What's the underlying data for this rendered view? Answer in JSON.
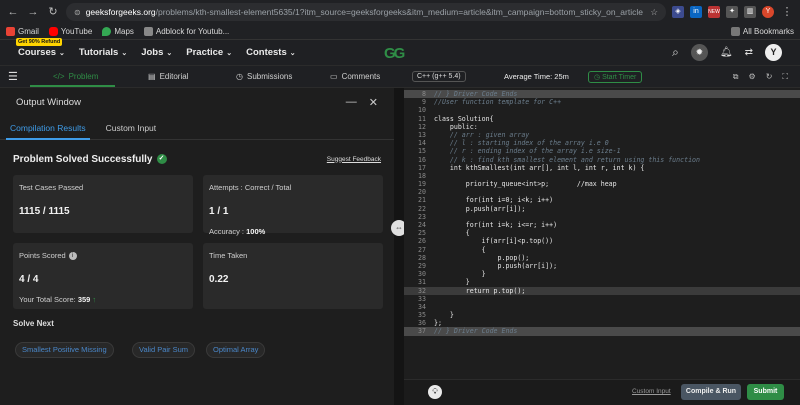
{
  "browser": {
    "url_domain": "geeksforgeeks.org",
    "url_rest": "/problems/kth-smallest-element5635/1?itm_source=geeksforgeeks&itm_medium=article&itm_campaign=bottom_sticky_on_article",
    "profile_initial": "Y",
    "ext_badge": "NEW"
  },
  "bookmarks": {
    "items": [
      "Gmail",
      "YouTube",
      "Maps",
      "Adblock for Youtub..."
    ],
    "all_label": "All Bookmarks"
  },
  "gfg_nav": {
    "refund_badge": "Get 90% Refund",
    "items": [
      "Courses",
      "Tutorials",
      "Jobs",
      "Practice",
      "Contests"
    ],
    "logo": "GG",
    "avatar": "Y"
  },
  "problem_tabs": [
    "Problem",
    "Editorial",
    "Submissions",
    "Comments"
  ],
  "editor_header": {
    "language": "C++ (g++ 5.4)",
    "avg_time": "Average Time: 25m",
    "start_timer": "Start Timer"
  },
  "output": {
    "title": "Output Window",
    "tabs": [
      "Compilation Results",
      "Custom Input"
    ],
    "status": "Problem Solved Successfully",
    "suggest_feedback": "Suggest Feedback",
    "cards": {
      "test_cases": {
        "label": "Test Cases Passed",
        "value": "1115 / 1115"
      },
      "attempts": {
        "label": "Attempts : Correct / Total",
        "value": "1 / 1",
        "sub_label": "Accuracy :",
        "sub_value": "100%"
      },
      "points": {
        "label": "Points Scored",
        "value": "4 / 4",
        "sub_label": "Your Total Score:",
        "sub_value": "359"
      },
      "time": {
        "label": "Time Taken",
        "value": "0.22"
      }
    },
    "solve_next": "Solve Next",
    "suggestions": [
      "Smallest Positive Missing",
      "Valid Pair Sum",
      "Optimal Array"
    ]
  },
  "code": {
    "lines": [
      {
        "n": "8",
        "t": "// } Driver Code Ends",
        "c": "cm",
        "hl": "greyhl"
      },
      {
        "n": "9",
        "t": "//User function template for C++",
        "c": "cm"
      },
      {
        "n": "10",
        "t": "",
        "c": ""
      },
      {
        "n": "11",
        "t": "class Solution{",
        "c": ""
      },
      {
        "n": "12",
        "t": "    public:",
        "c": ""
      },
      {
        "n": "13",
        "t": "    // arr : given array",
        "c": "cm"
      },
      {
        "n": "14",
        "t": "    // l : starting index of the array i.e 0",
        "c": "cm"
      },
      {
        "n": "15",
        "t": "    // r : ending index of the array i.e size-1",
        "c": "cm"
      },
      {
        "n": "16",
        "t": "    // k : find kth smallest element and return using this function",
        "c": "cm"
      },
      {
        "n": "17",
        "t": "    int kthSmallest(int arr[], int l, int r, int k) {",
        "c": ""
      },
      {
        "n": "18",
        "t": "",
        "c": ""
      },
      {
        "n": "19",
        "t": "        priority_queue<int>p;       //max heap",
        "c": ""
      },
      {
        "n": "20",
        "t": "",
        "c": ""
      },
      {
        "n": "21",
        "t": "        for(int i=0; i<k; i++)",
        "c": ""
      },
      {
        "n": "22",
        "t": "        p.push(arr[i]);",
        "c": ""
      },
      {
        "n": "23",
        "t": "",
        "c": ""
      },
      {
        "n": "24",
        "t": "        for(int i=k; i<=r; i++)",
        "c": ""
      },
      {
        "n": "25",
        "t": "        {",
        "c": ""
      },
      {
        "n": "26",
        "t": "            if(arr[i]<p.top())",
        "c": ""
      },
      {
        "n": "27",
        "t": "            {",
        "c": ""
      },
      {
        "n": "28",
        "t": "                p.pop();",
        "c": ""
      },
      {
        "n": "29",
        "t": "                p.push(arr[i]);",
        "c": ""
      },
      {
        "n": "30",
        "t": "            }",
        "c": ""
      },
      {
        "n": "31",
        "t": "        }",
        "c": ""
      },
      {
        "n": "32",
        "t": "        return p.top();",
        "c": "",
        "hl": "hl"
      },
      {
        "n": "33",
        "t": "",
        "c": ""
      },
      {
        "n": "34",
        "t": "",
        "c": ""
      },
      {
        "n": "35",
        "t": "    }",
        "c": ""
      },
      {
        "n": "36",
        "t": "};",
        "c": ""
      },
      {
        "n": "37",
        "t": "// } Driver Code Ends",
        "c": "cm",
        "hl": "greyhl"
      }
    ]
  },
  "editor_footer": {
    "custom_input": "Custom Input",
    "compile": "Compile & Run",
    "submit": "Submit"
  },
  "colors": {
    "brand_green": "#2f8d46",
    "accent_blue": "#3f9ce8"
  }
}
